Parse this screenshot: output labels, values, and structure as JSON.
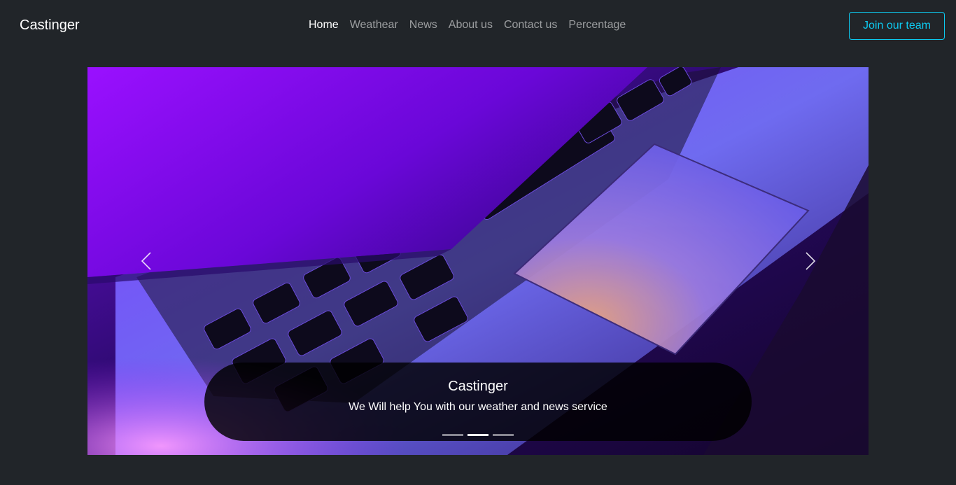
{
  "navbar": {
    "brand": "Castinger",
    "links": [
      {
        "label": "Home",
        "active": true
      },
      {
        "label": "Weathear",
        "active": false
      },
      {
        "label": "News",
        "active": false
      },
      {
        "label": "About us",
        "active": false
      },
      {
        "label": "Contact us",
        "active": false
      },
      {
        "label": "Percentage",
        "active": false
      }
    ],
    "cta_label": "Join our team"
  },
  "carousel": {
    "caption_title": "Castinger",
    "caption_text": "We Will help You with our weather and news service",
    "slide_count": 3,
    "active_index": 1,
    "prev_icon": "chevron-left-icon",
    "next_icon": "chevron-right-icon"
  },
  "colors": {
    "background": "#212529",
    "accent": "#0dcaf0",
    "nav_inactive": "rgba(255,255,255,0.55)"
  }
}
